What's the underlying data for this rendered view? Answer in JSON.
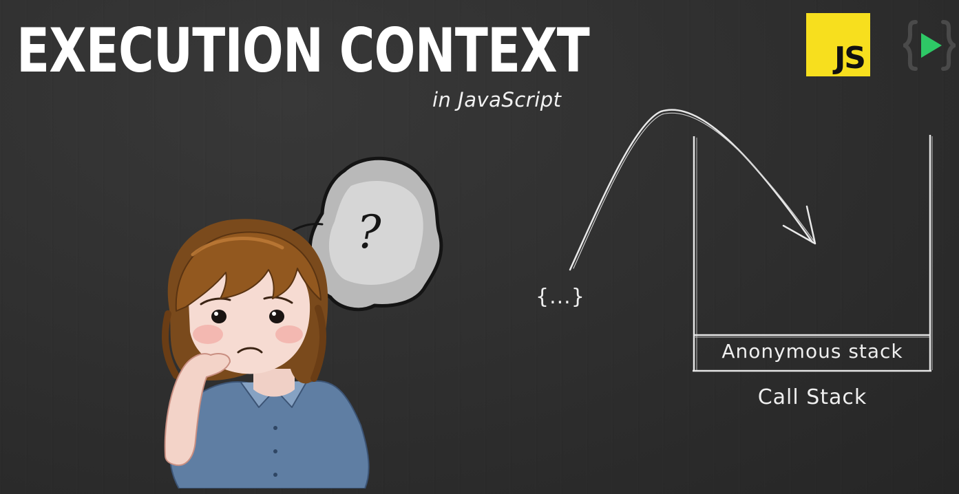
{
  "slide": {
    "title": "EXECUTION CONTEXT",
    "subtitle": "in JavaScript",
    "js_badge": "JS",
    "accent_color": "#f7df1e",
    "logo_play_color": "#2ec866"
  },
  "diagram": {
    "code_block_label": "{...}",
    "stack_frame_label": "Anonymous stack",
    "stack_caption": "Call Stack"
  },
  "illustration": {
    "thought_mark": "?"
  }
}
